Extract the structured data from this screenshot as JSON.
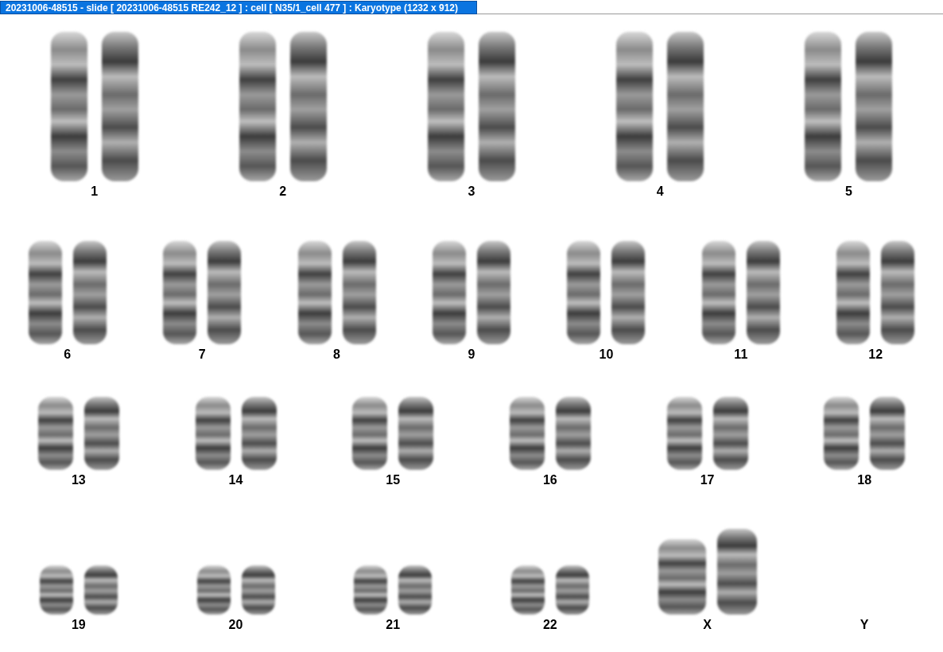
{
  "window": {
    "title": "20231006-48515 - slide [ 20231006-48515 RE242_12 ] : cell [ N35/1_cell 477 ] : Karyotype  (1232 x 912)"
  },
  "rows": [
    {
      "pairs": [
        {
          "label": "1",
          "kind": "pair"
        },
        {
          "label": "2",
          "kind": "pair"
        },
        {
          "label": "3",
          "kind": "pair"
        },
        {
          "label": "4",
          "kind": "pair"
        },
        {
          "label": "5",
          "kind": "pair"
        }
      ]
    },
    {
      "pairs": [
        {
          "label": "6",
          "kind": "pair"
        },
        {
          "label": "7",
          "kind": "pair"
        },
        {
          "label": "8",
          "kind": "pair"
        },
        {
          "label": "9",
          "kind": "pair"
        },
        {
          "label": "10",
          "kind": "pair"
        },
        {
          "label": "11",
          "kind": "pair"
        },
        {
          "label": "12",
          "kind": "pair"
        }
      ]
    },
    {
      "pairs": [
        {
          "label": "13",
          "kind": "pair"
        },
        {
          "label": "14",
          "kind": "pair"
        },
        {
          "label": "15",
          "kind": "pair"
        },
        {
          "label": "16",
          "kind": "pair"
        },
        {
          "label": "17",
          "kind": "pair"
        },
        {
          "label": "18",
          "kind": "pair"
        }
      ]
    },
    {
      "pairs": [
        {
          "label": "19",
          "kind": "pair"
        },
        {
          "label": "20",
          "kind": "pair"
        },
        {
          "label": "21",
          "kind": "pair"
        },
        {
          "label": "22",
          "kind": "pair"
        },
        {
          "label": "X",
          "kind": "pair"
        },
        {
          "label": "Y",
          "kind": "empty"
        }
      ]
    }
  ]
}
